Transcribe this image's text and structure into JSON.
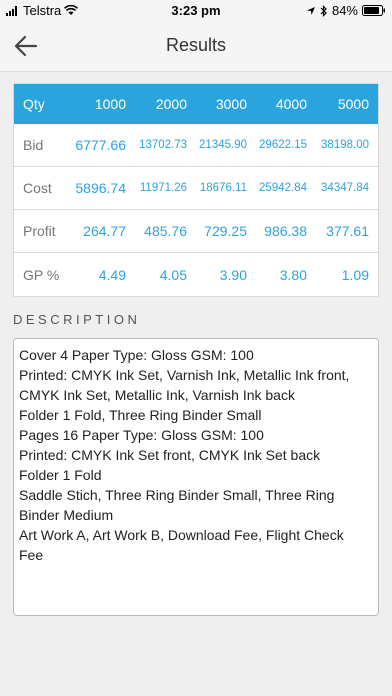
{
  "status": {
    "carrier": "Telstra",
    "time": "3:23 pm",
    "battery": "84%"
  },
  "nav": {
    "title": "Results"
  },
  "table": {
    "header": {
      "label": "Qty",
      "values": [
        "1000",
        "2000",
        "3000",
        "4000",
        "5000"
      ]
    },
    "rows": [
      {
        "label": "Bid",
        "values": [
          "6777.66",
          "13702.73",
          "21345.90",
          "29622.15",
          "38198.00"
        ]
      },
      {
        "label": "Cost",
        "values": [
          "5896.74",
          "11971.26",
          "18676.11",
          "25942.84",
          "34347.84"
        ]
      },
      {
        "label": "Profit",
        "values": [
          "264.77",
          "485.76",
          "729.25",
          "986.38",
          "377.61"
        ]
      },
      {
        "label": "GP %",
        "values": [
          "4.49",
          "4.05",
          "3.90",
          "3.80",
          "1.09"
        ]
      }
    ]
  },
  "description": {
    "label": "DESCRIPTION",
    "lines": [
      "Cover 4 Paper Type: Gloss GSM: 100",
      "Printed: CMYK Ink Set, Varnish Ink, Metallic Ink front,",
      "CMYK Ink Set, Metallic Ink, Varnish Ink back",
      "Folder 1 Fold, Three Ring Binder Small",
      "Pages 16 Paper Type: Gloss GSM: 100",
      "Printed: CMYK Ink Set front, CMYK Ink Set back",
      "Folder 1 Fold",
      "Saddle Stich, Three Ring Binder Small, Three Ring",
      "Binder Medium",
      "Art Work A, Art Work B, Download Fee, Flight Check",
      "Fee"
    ]
  },
  "colors": {
    "accent": "#2ba3dc"
  }
}
